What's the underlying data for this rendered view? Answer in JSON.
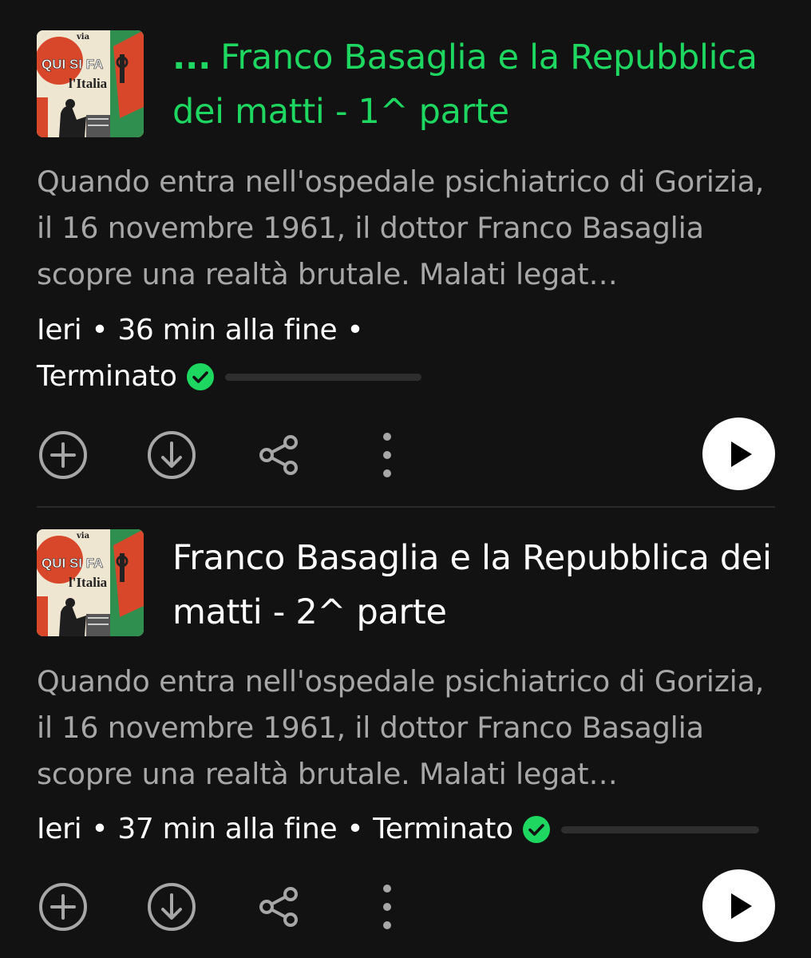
{
  "episodes": [
    {
      "title_prefix": "...",
      "title": "Franco Basaglia e la Repubblica dei matti - 1^ parte",
      "description": "Quando entra nell'ospedale psichiatrico di Gorizia, il 16 novembre 1961, il dottor Franco Basaglia scopre una realtà brutale. Malati legat…",
      "date": "Ieri",
      "separator": "•",
      "remaining": "36 min alla fine",
      "status": "Terminato",
      "is_playing": true,
      "progress_fraction": 0,
      "cover_icon": "podcast-cover-qui-si-fa-litalia"
    },
    {
      "title_prefix": "",
      "title": "Franco Basaglia e la Repubblica dei matti - 2^ parte",
      "description": "Quando entra nell'ospedale psichiatrico di Gorizia, il 16 novembre 1961, il dottor Franco Basaglia scopre una realtà brutale. Malati legat…",
      "date": "Ieri",
      "separator": "•",
      "remaining": "37 min alla fine",
      "status": "Terminato",
      "is_playing": false,
      "progress_fraction": 0,
      "cover_icon": "podcast-cover-qui-si-fa-litalia"
    }
  ],
  "cover_art": {
    "line1": "QUI SI FA",
    "line2": "l'Italia",
    "small": "via"
  },
  "icons": {
    "add": "add-circle-icon",
    "download": "download-circle-icon",
    "share": "share-icon",
    "more": "more-vertical-icon",
    "play": "play-icon",
    "check": "check-circle-icon"
  },
  "colors": {
    "background": "#121212",
    "accent": "#1ed760",
    "text_primary": "#ffffff",
    "text_secondary": "#a7a7a7",
    "icon_gray": "#a7a7a7",
    "progress_track": "#2e2e2e"
  }
}
